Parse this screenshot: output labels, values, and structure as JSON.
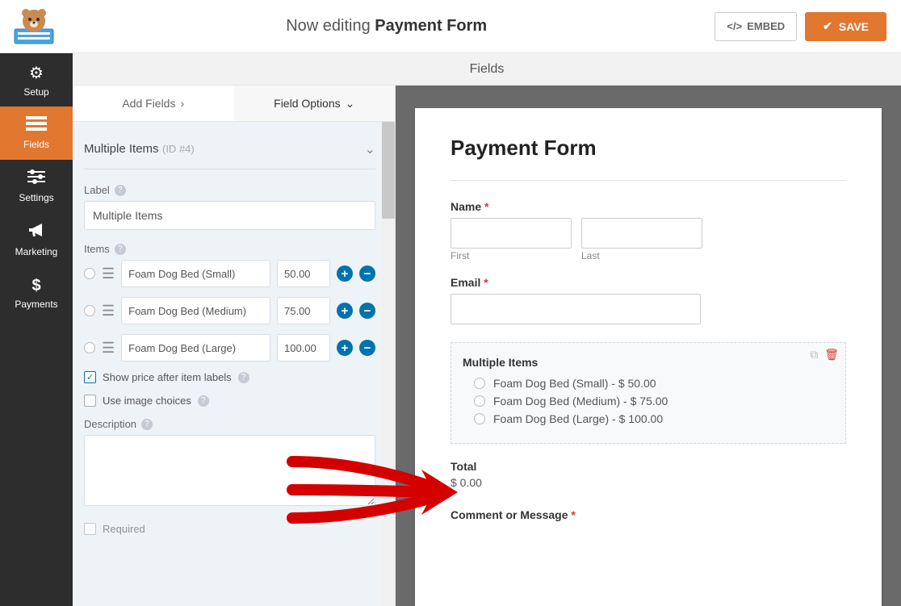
{
  "header": {
    "now_editing": "Now editing",
    "form_name": "Payment Form",
    "embed_label": "EMBED",
    "save_label": "SAVE"
  },
  "nav": {
    "setup": "Setup",
    "fields": "Fields",
    "settings": "Settings",
    "marketing": "Marketing",
    "payments": "Payments"
  },
  "section_header": "Fields",
  "tabs": {
    "add": "Add Fields",
    "options": "Field Options"
  },
  "panel": {
    "group": "Multiple Items",
    "group_id": "(ID #4)",
    "label_lbl": "Label",
    "label_val": "Multiple Items",
    "items_lbl": "Items",
    "items": [
      {
        "name": "Foam Dog Bed (Small)",
        "price": "50.00"
      },
      {
        "name": "Foam Dog Bed (Medium)",
        "price": "75.00"
      },
      {
        "name": "Foam Dog Bed (Large)",
        "price": "100.00"
      }
    ],
    "show_price": "Show price after item labels",
    "image_choices": "Use image choices",
    "desc_lbl": "Description",
    "desc_val": "",
    "required": "Required"
  },
  "preview": {
    "title": "Payment Form",
    "name_label": "Name",
    "first_sub": "First",
    "last_sub": "Last",
    "email_label": "Email",
    "mi_label": "Multiple Items",
    "options": [
      "Foam Dog Bed (Small) - $ 50.00",
      "Foam Dog Bed (Medium) - $ 75.00",
      "Foam Dog Bed (Large) - $ 100.00"
    ],
    "total_label": "Total",
    "total_value": "$ 0.00",
    "comment_label": "Comment or Message"
  }
}
